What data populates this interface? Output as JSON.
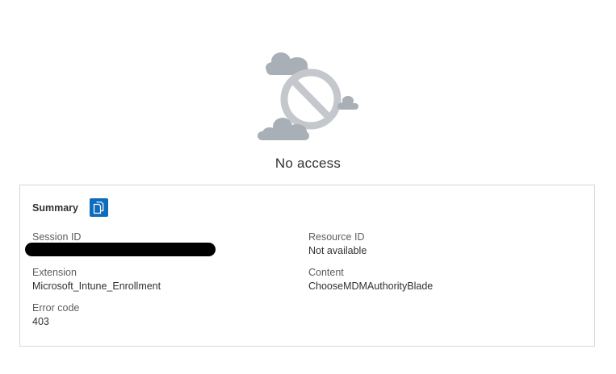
{
  "title": "No access",
  "summary": {
    "title": "Summary",
    "copy_icon": "copy-icon",
    "fields": {
      "session_id": {
        "label": "Session ID",
        "value": ""
      },
      "resource_id": {
        "label": "Resource ID",
        "value": "Not available"
      },
      "extension": {
        "label": "Extension",
        "value": "Microsoft_Intune_Enrollment"
      },
      "content": {
        "label": "Content",
        "value": "ChooseMDMAuthorityBlade"
      },
      "error_code": {
        "label": "Error code",
        "value": "403"
      }
    }
  },
  "colors": {
    "accent": "#0f6cbd",
    "illustration_gray": "#c4c8cc",
    "cloud_gray": "#a8afb7",
    "border": "#d6d6d6"
  }
}
